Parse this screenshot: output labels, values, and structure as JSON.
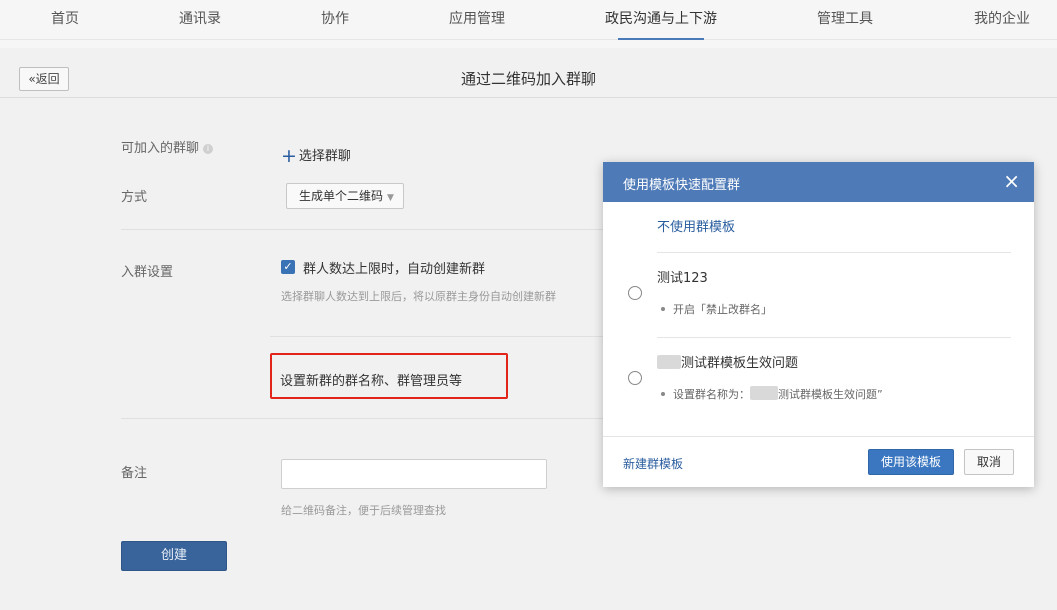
{
  "nav": {
    "items": [
      {
        "label": "首页"
      },
      {
        "label": "通讯录"
      },
      {
        "label": "协作"
      },
      {
        "label": "应用管理"
      },
      {
        "label": "政民沟通与上下游",
        "active": true
      },
      {
        "label": "管理工具"
      },
      {
        "label": "我的企业"
      }
    ]
  },
  "header": {
    "back_label": "«返回",
    "title": "通过二维码加入群聊"
  },
  "form": {
    "joinable_label": "可加入的群聊",
    "info_icon": "i",
    "select_group_label": "选择群聊",
    "method_label": "方式",
    "method_value": "生成单个二维码",
    "join_settings_label": "入群设置",
    "auto_create_label": "群人数达上限时，自动创建新群",
    "auto_create_checked": true,
    "auto_create_hint": "选择群聊人数达到上限后，将以原群主身份自动创建新群",
    "new_group_settings": "设置新群的群名称、群管理员等",
    "remark_label": "备注",
    "remark_value": "",
    "remark_hint": "给二维码备注，便于后续管理查找",
    "create_label": "创建"
  },
  "modal": {
    "title": "使用模板快速配置群",
    "close_icon": "×",
    "no_template_label": "不使用群模板",
    "templates": [
      {
        "name": "测试123",
        "detail": "开启「禁止改群名」"
      },
      {
        "name": "测试群模板生效问题",
        "detail_prefix": "设置群名称为：",
        "detail_suffix": "测试群模板生效问题”"
      }
    ],
    "new_template_label": "新建群模板",
    "use_button": "使用该模板",
    "cancel_button": "取消"
  }
}
